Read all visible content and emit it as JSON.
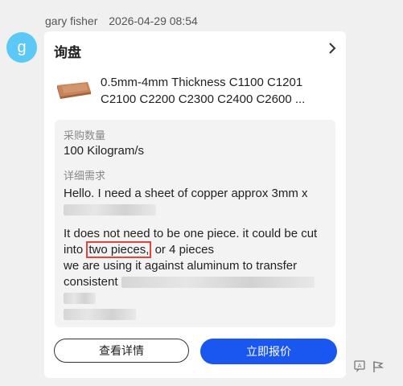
{
  "message": {
    "sender": "gary fisher",
    "timestamp": "2026-04-29 08:54",
    "avatar_letter": "g"
  },
  "card": {
    "title": "询盘",
    "product_title": "0.5mm-4mm Thickness C1100 C1201 C2100 C2200 C2300 C2400 C2600 ...",
    "quantity_label": "采购数量",
    "quantity_value": "100 Kilogram/s",
    "requirement_label": "详细需求",
    "line1": "Hello. I need a sheet of copper approx 3mm x",
    "line2a": "It does not need to be one piece. it could be cut into",
    "highlight_text": "two pieces,",
    "line2b": "or 4 pieces",
    "line3": "we are using it against aluminum to transfer",
    "line4": "consistent",
    "detail_button": "查看详情",
    "quote_button": "立即报价"
  },
  "colors": {
    "avatar": "#5bc8f5",
    "primary": "#1a56f0",
    "highlight_border": "#e0443e"
  },
  "icons": [
    "chevron-right-icon",
    "translate-icon",
    "flag-icon"
  ]
}
